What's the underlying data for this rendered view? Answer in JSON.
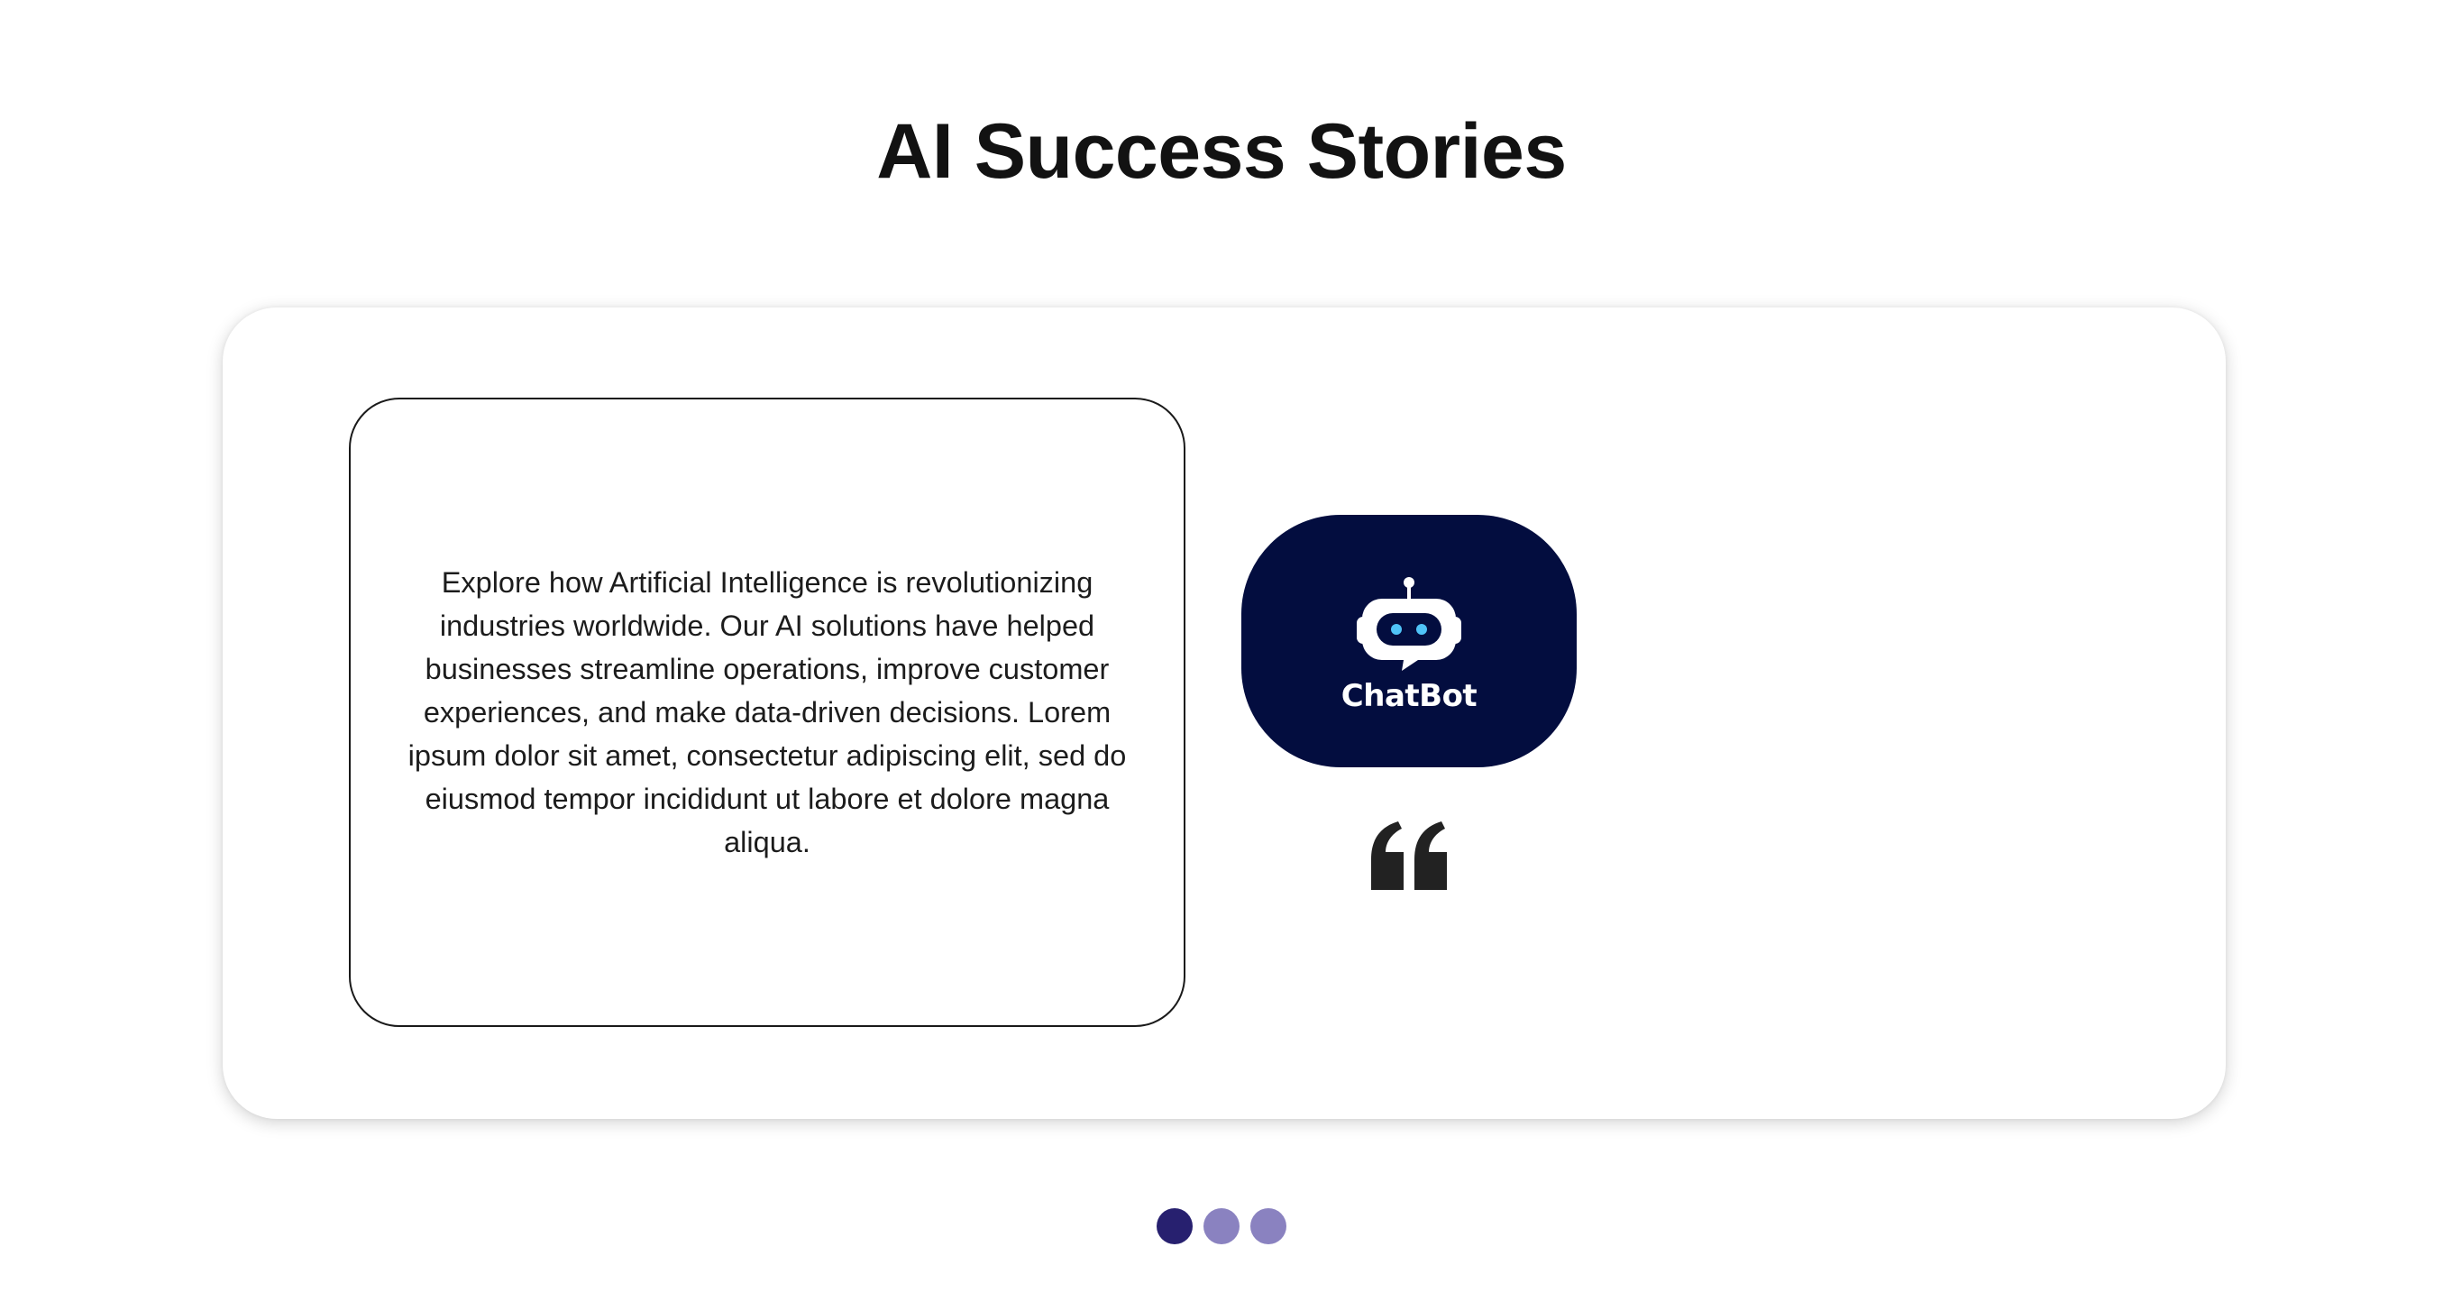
{
  "page": {
    "title": "AI Success Stories"
  },
  "story": {
    "text": "Explore how Artificial Intelligence is revolutionizing industries worldwide. Our AI solutions have helped businesses streamline operations, improve customer experiences, and make data-driven decisions. Lorem ipsum dolor sit amet, consectetur adipiscing elit, sed do eiusmod tempor incididunt ut labore et dolore magna aliqua."
  },
  "logo": {
    "text": "ChatBot",
    "icon": "robot-icon",
    "background": "#030d3f"
  },
  "quote": {
    "icon": "quote-icon",
    "color": "#222222"
  },
  "pagination": {
    "dots": [
      {
        "active": true,
        "color": "#27206f"
      },
      {
        "active": false,
        "color": "#8a82c0"
      },
      {
        "active": false,
        "color": "#8a82c0"
      }
    ]
  }
}
